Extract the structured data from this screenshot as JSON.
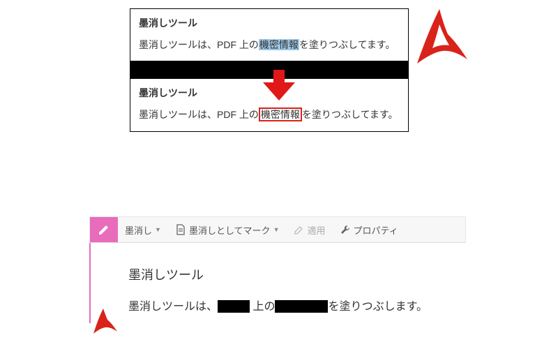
{
  "top": {
    "header": "墨消しツール",
    "line_before": "墨消しツールは、PDF 上の",
    "highlighted": "機密情報",
    "line_after": "を塗りつぶしてます。"
  },
  "bottom_box": {
    "header": "墨消しツール",
    "line_before": "墨消しツールは、PDF 上の",
    "boxed": "機密情報",
    "line_after": "を塗りつぶしてます。"
  },
  "toolbar": {
    "redact_label": "墨消し",
    "mark_label": "墨消しとしてマーク",
    "apply_label": "適用",
    "properties_label": "プロパティ"
  },
  "bottom_doc": {
    "header": "墨消しツール",
    "part1": "墨消しツールは、",
    "part2": "上の",
    "part3": "を塗りつぶします。"
  }
}
